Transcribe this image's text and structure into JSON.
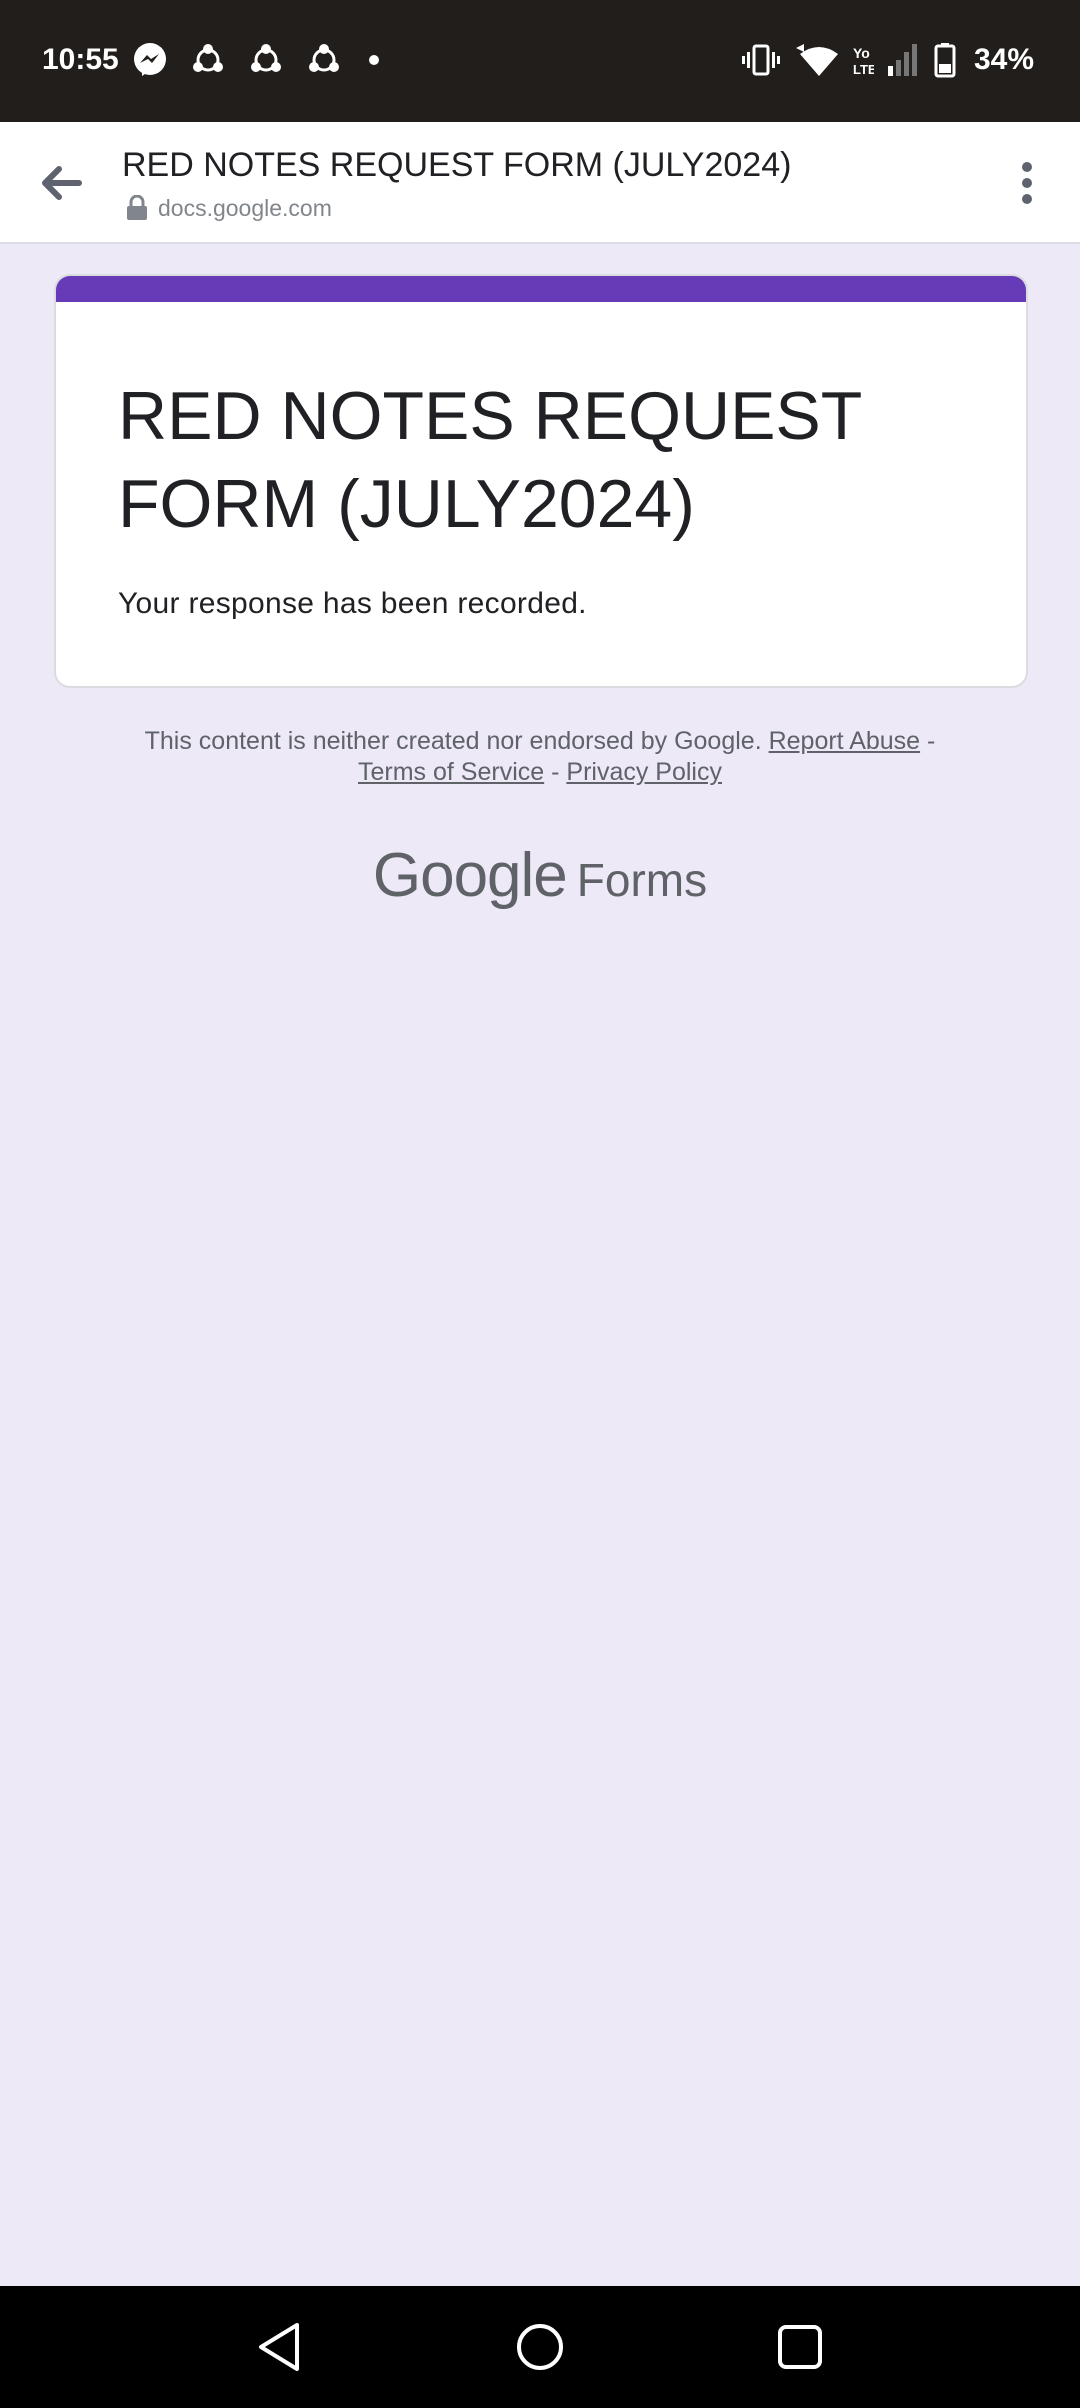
{
  "status_bar": {
    "time": "10:55",
    "battery": "34%",
    "left_icons": [
      "messenger-icon",
      "app-notification-icon",
      "app-notification-icon",
      "app-notification-icon",
      "more-notifications-dot-icon"
    ],
    "right_icons": [
      "vibrate-icon",
      "wifi-icon",
      "volte-icon",
      "signal-icon",
      "battery-icon"
    ]
  },
  "toolbar": {
    "title": "RED NOTES REQUEST FORM (JULY2024)",
    "url": "docs.google.com"
  },
  "form": {
    "title": "RED NOTES REQUEST FORM (JULY2024)",
    "response": "Your response has been recorded.",
    "accent_color": "#673ab7"
  },
  "footer": {
    "disclaimer": "This content is neither created nor endorsed by Google.",
    "report_abuse": "Report Abuse",
    "sep1": " - ",
    "terms": "Terms of Service",
    "sep2": " - ",
    "privacy": "Privacy Policy",
    "brand_google": "Google",
    "brand_forms": "Forms"
  },
  "nav_bar": {
    "buttons": [
      "back-triangle-icon",
      "home-circle-icon",
      "recents-square-icon"
    ]
  }
}
